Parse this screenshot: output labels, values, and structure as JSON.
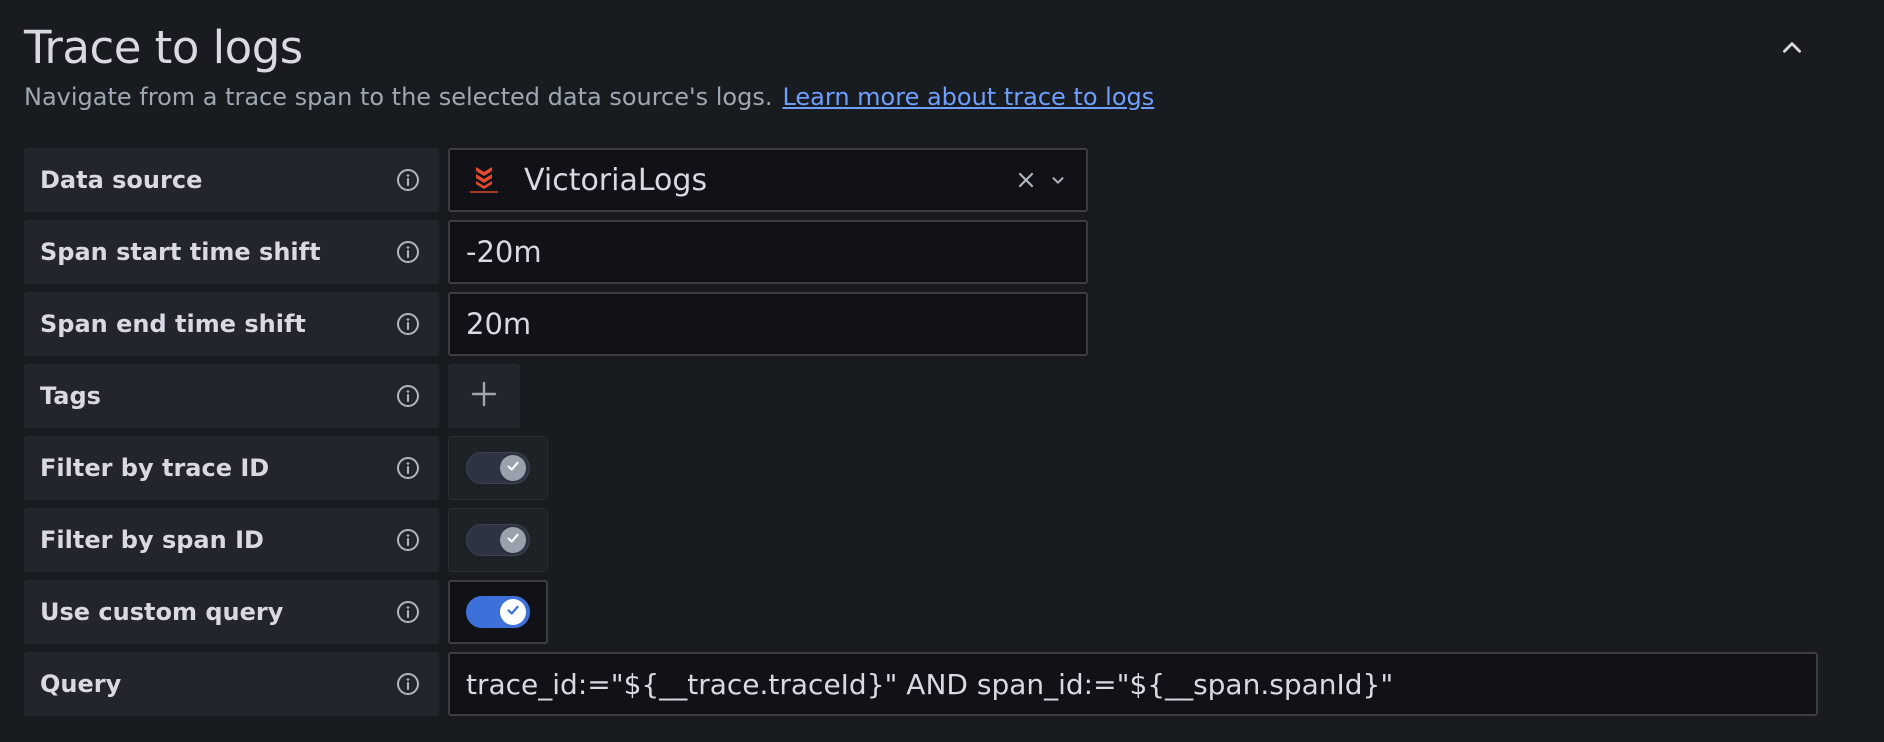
{
  "header": {
    "title": "Trace to logs",
    "description": "Navigate from a trace span to the selected data source's logs.",
    "link_text": "Learn more about trace to logs"
  },
  "fields": {
    "data_source": {
      "label": "Data source",
      "value": "VictoriaLogs",
      "logo_text": "VictoriaLogs"
    },
    "span_start": {
      "label": "Span start time shift",
      "value": "-20m"
    },
    "span_end": {
      "label": "Span end time shift",
      "value": "20m"
    },
    "tags": {
      "label": "Tags"
    },
    "filter_trace": {
      "label": "Filter by trace ID",
      "checked": true
    },
    "filter_span": {
      "label": "Filter by span ID",
      "checked": true
    },
    "custom_query": {
      "label": "Use custom query",
      "checked": true
    },
    "query": {
      "label": "Query",
      "value": "trace_id:=\"${__trace.traceId}\" AND span_id:=\"${__span.spanId}\""
    }
  },
  "icons": {
    "info": "info-circle-icon",
    "collapse": "chevron-up-icon",
    "clear": "close-icon",
    "dropdown": "chevron-down-icon",
    "add": "plus-icon",
    "check": "check-icon"
  },
  "colors": {
    "background": "#181b1f",
    "label_bg": "#22252b",
    "link": "#6e9fff",
    "switch_active": "#3d71d9",
    "brand_logo": "#e64a2e"
  }
}
